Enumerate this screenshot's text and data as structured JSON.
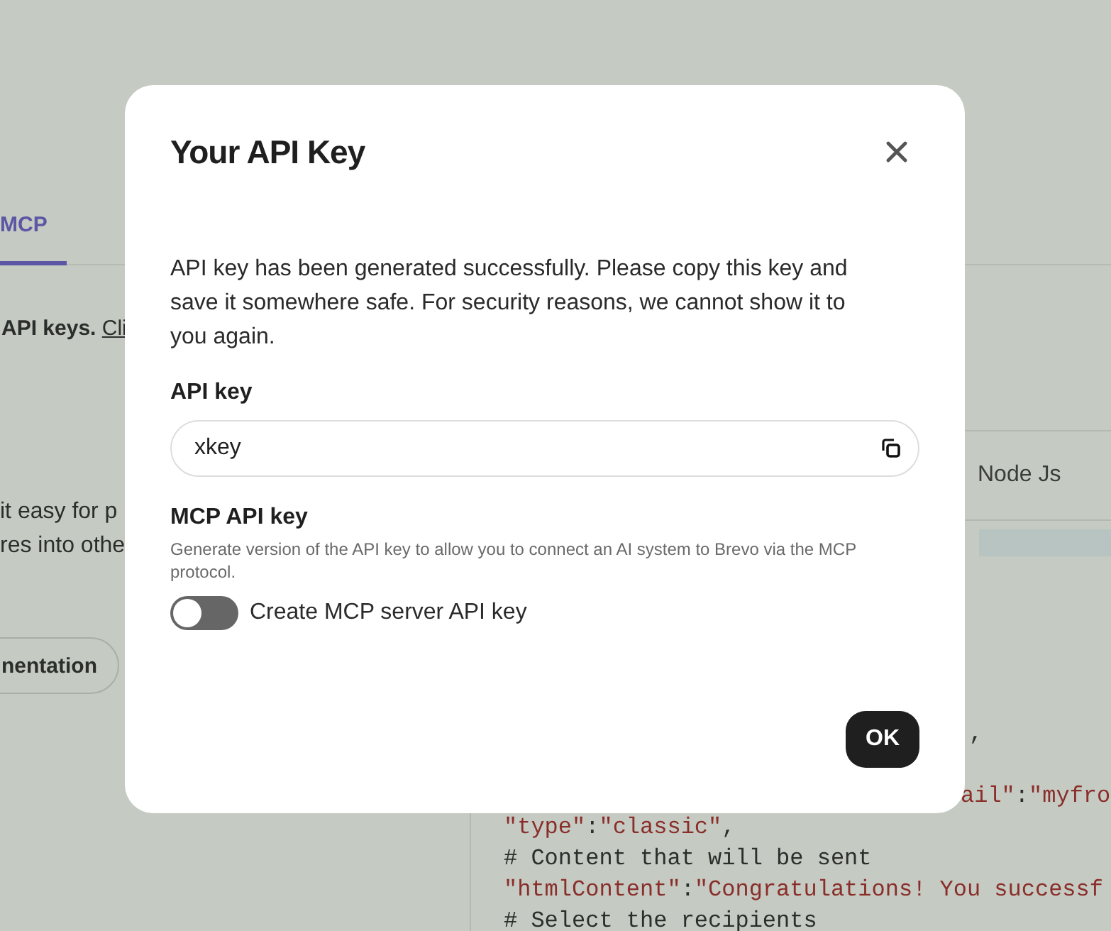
{
  "background": {
    "tabs": [
      {
        "label": "MCP",
        "selected": true
      }
    ],
    "intro": {
      "text": "API keys.",
      "link": "Cli"
    },
    "paragraph_lines": [
      "it easy for p",
      "res into othe"
    ],
    "documentation_button": "nentation",
    "code_tabs": [
      {
        "label": "Node Js",
        "selected": false
      }
    ],
    "code_lines": [
      {
        "kind": "tail",
        "segments": [
          {
            "text": ",",
            "kind": "plain"
          }
        ]
      },
      {
        "kind": "tail",
        "segments": [
          {
            "text": "ail\"",
            "kind": "str"
          },
          {
            "text": ":",
            "kind": "plain"
          },
          {
            "text": "\"myfro",
            "kind": "str"
          }
        ]
      },
      {
        "kind": "full",
        "segments": [
          {
            "text": "\"type\"",
            "kind": "str"
          },
          {
            "text": ":",
            "kind": "plain"
          },
          {
            "text": "\"classic\"",
            "kind": "str"
          },
          {
            "text": ",",
            "kind": "plain"
          }
        ]
      },
      {
        "kind": "full",
        "segments": [
          {
            "text": "# Content that will be sent",
            "kind": "comment"
          }
        ]
      },
      {
        "kind": "full",
        "segments": [
          {
            "text": "\"htmlContent\"",
            "kind": "str"
          },
          {
            "text": ":",
            "kind": "plain"
          },
          {
            "text": "\"Congratulations! You successf",
            "kind": "str"
          }
        ]
      },
      {
        "kind": "full",
        "segments": [
          {
            "text": "# Select the recipients",
            "kind": "comment"
          }
        ]
      }
    ]
  },
  "dialog": {
    "title": "Your API Key",
    "message": "API key has been generated successfully. Please copy this key and save it somewhere safe. For security reasons, we cannot show it to you again.",
    "api_key_label": "API key",
    "api_key_value": "xkey",
    "mcp_label": "MCP API key",
    "mcp_description": "Generate version of the API key to allow you to connect an AI system to Brevo via the MCP protocol.",
    "toggle": {
      "label": "Create MCP server API key",
      "on": false
    },
    "ok_button": "OK"
  }
}
